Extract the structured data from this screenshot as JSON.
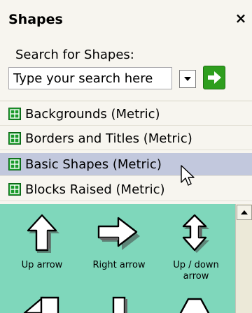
{
  "panel": {
    "title": "Shapes",
    "close_label": "×"
  },
  "search": {
    "label": "Search for Shapes:",
    "placeholder": "Type your search here",
    "value": "Type your search here"
  },
  "stencils": [
    {
      "label": "Backgrounds (Metric)",
      "selected": false
    },
    {
      "label": "Borders and Titles (Metric)",
      "selected": false
    },
    {
      "label": "Basic Shapes (Metric)",
      "selected": true
    },
    {
      "label": "Blocks Raised (Metric)",
      "selected": false
    }
  ],
  "shapes": [
    {
      "label": "Up arrow",
      "icon": "up-arrow-icon"
    },
    {
      "label": "Right arrow",
      "icon": "right-arrow-icon"
    },
    {
      "label": "Up / down arrow",
      "icon": "up-down-arrow-icon"
    }
  ],
  "colors": {
    "pane_bg": "#7fd7bb",
    "selected_bg": "#c2c8dd",
    "go_button": "#2e9e1e",
    "stencil_icon": "#1a9a2a"
  }
}
